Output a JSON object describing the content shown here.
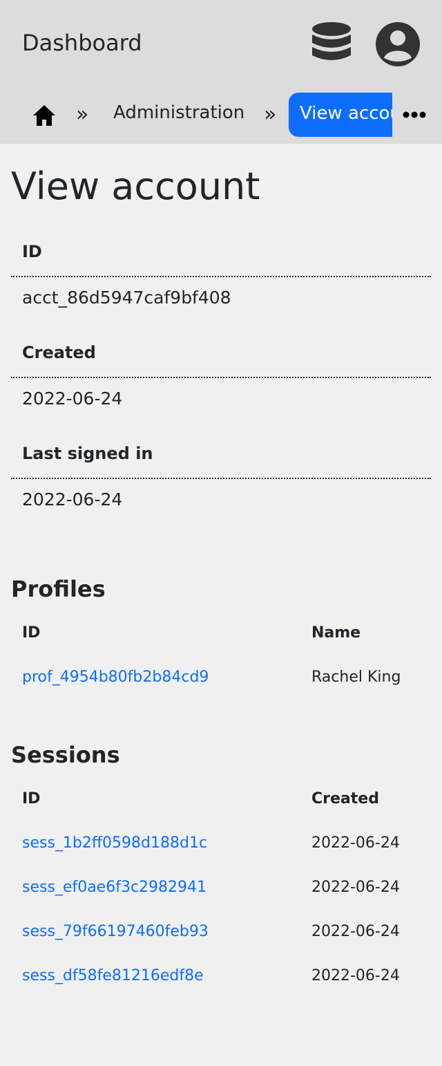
{
  "header": {
    "title": "Dashboard",
    "icons": [
      "database-icon",
      "account-circle-icon"
    ]
  },
  "breadcrumb": {
    "home_icon": "home-icon",
    "separator": "»",
    "items": [
      {
        "label": "Administration"
      },
      {
        "label": "View account",
        "active": true
      }
    ],
    "more_icon": "more-horizontal-icon"
  },
  "page": {
    "title": "View account"
  },
  "details": [
    {
      "label": "ID",
      "value": "acct_86d5947caf9bf408"
    },
    {
      "label": "Created",
      "value": "2022-06-24"
    },
    {
      "label": "Last signed in",
      "value": "2022-06-24"
    }
  ],
  "profiles": {
    "title": "Profiles",
    "columns": [
      "ID",
      "Name"
    ],
    "rows": [
      {
        "id": "prof_4954b80fb2b84cd9",
        "name": "Rachel King"
      }
    ]
  },
  "sessions": {
    "title": "Sessions",
    "columns": [
      "ID",
      "Created"
    ],
    "rows": [
      {
        "id": "sess_1b2ff0598d188d1c",
        "created": "2022-06-24"
      },
      {
        "id": "sess_ef0ae6f3c2982941",
        "created": "2022-06-24"
      },
      {
        "id": "sess_79f66197460feb93",
        "created": "2022-06-24"
      },
      {
        "id": "sess_df58fe81216edf8e",
        "created": "2022-06-24"
      }
    ]
  },
  "colors": {
    "header_bg": "#dcdcdc",
    "page_bg": "#f0f0f0",
    "accent": "#0d6efd",
    "text": "#212529"
  }
}
